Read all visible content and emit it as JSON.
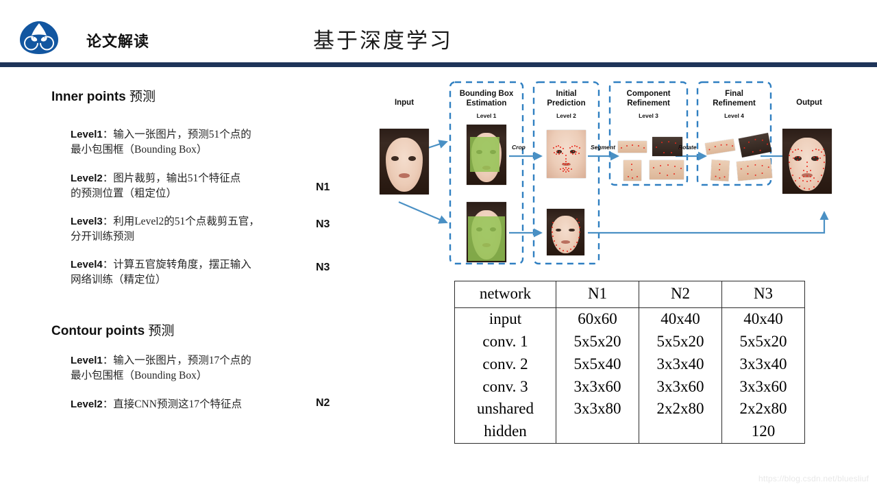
{
  "header": {
    "logo_icon": "cloud-spiral-logo",
    "brand_title": "论文解读",
    "slide_title": "基于深度学习",
    "rule_color": "#1e3459",
    "logo_color": "#1256a0"
  },
  "left": {
    "sections": [
      {
        "heading_latin": "Inner points",
        "heading_cn": "预测",
        "items": [
          {
            "label": "Level1",
            "colon": "：",
            "text_line1": "输入一张图片，预测51个点的",
            "text_line2": "最小包围框（Bounding Box）",
            "network": ""
          },
          {
            "label": "Level2",
            "colon": "：",
            "text_line1": "图片裁剪，输出51个特征点",
            "text_line2": "的预测位置（粗定位）",
            "network": "N1"
          },
          {
            "label": "Level3",
            "colon": "：",
            "text_line1": "利用Level2的51个点裁剪五官，",
            "text_line2": "分开训练预测",
            "network": "N3"
          },
          {
            "label": "Level4",
            "colon": "：",
            "text_line1": "计算五官旋转角度，摆正输入",
            "text_line2": "网络训练（精定位）",
            "network": "N3"
          }
        ]
      },
      {
        "heading_latin": "Contour points",
        "heading_cn": "预测",
        "items": [
          {
            "label": "Level1",
            "colon": "：",
            "text_line1": "输入一张图片，预测17个点的",
            "text_line2": "最小包围框（Bounding Box）",
            "network": ""
          },
          {
            "label": "Level2",
            "colon": "：",
            "text_line1": "直接CNN预测这17个特征点",
            "text_line2": "",
            "network": "N2"
          }
        ]
      }
    ]
  },
  "diagram": {
    "input_label": "Input",
    "output_label": "Output",
    "stages": [
      {
        "title_line1": "Bounding Box",
        "title_line2": "Estimation",
        "level": "Level 1"
      },
      {
        "title_line1": "Initial",
        "title_line2": "Prediction",
        "level": "Level 2"
      },
      {
        "title_line1": "Component",
        "title_line2": "Refinement",
        "level": "Level 3"
      },
      {
        "title_line1": "Final",
        "title_line2": "Refinement",
        "level": "Level 4"
      }
    ],
    "arrow_labels": [
      "Crop",
      "Segment",
      "Rotate"
    ],
    "accent_color": "#4a90c4",
    "box_color": "#2f7fc1",
    "bbox_color": "#92c353",
    "landmark_color": "#e8261a"
  },
  "chart_data": {
    "type": "table",
    "title": "network architecture table",
    "columns": [
      "network",
      "N1",
      "N2",
      "N3"
    ],
    "rows": [
      [
        "input",
        "60x60",
        "40x40",
        "40x40"
      ],
      [
        "conv. 1",
        "5x5x20",
        "5x5x20",
        "5x5x20"
      ],
      [
        "conv. 2",
        "5x5x40",
        "3x3x40",
        "3x3x40"
      ],
      [
        "conv. 3",
        "3x3x60",
        "3x3x60",
        "3x3x60"
      ],
      [
        "unshared",
        "3x3x80",
        "2x2x80",
        "2x2x80"
      ],
      [
        "hidden",
        "",
        "",
        "120"
      ]
    ]
  },
  "watermark": "https://blog.csdn.net/bluesliuf"
}
